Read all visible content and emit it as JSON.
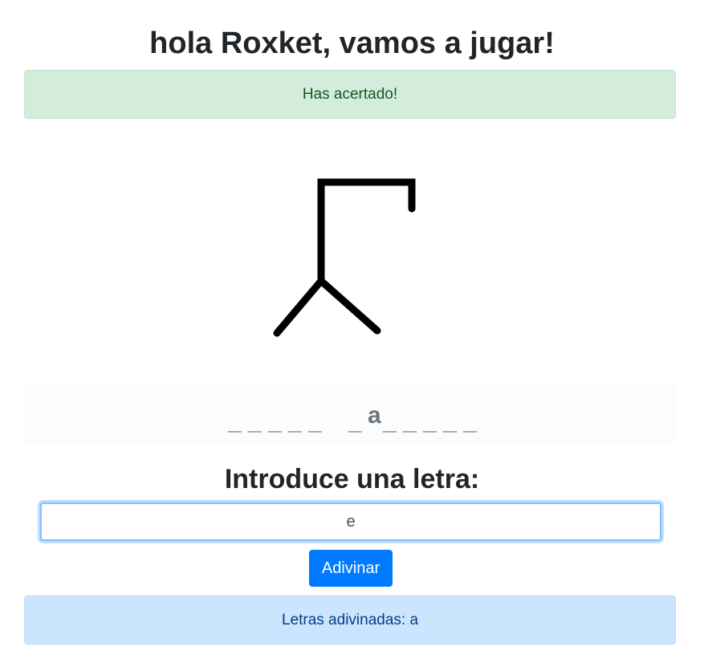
{
  "header": {
    "title": "hola Roxket, vamos a jugar!"
  },
  "alerts": {
    "result": "Has acertado!",
    "guessed_letters": "Letras adivinadas: a"
  },
  "word": {
    "group1": "_ _ _ _ _",
    "group2_prefix": "_",
    "revealed": "a",
    "group2_suffix": "_ _ _ _ _"
  },
  "form": {
    "prompt": "Introduce una letra:",
    "input_value": "e",
    "button_label": "Adivinar"
  },
  "colors": {
    "success_bg": "#d4edda",
    "info_bg": "#cce5ff",
    "primary": "#007bff"
  }
}
